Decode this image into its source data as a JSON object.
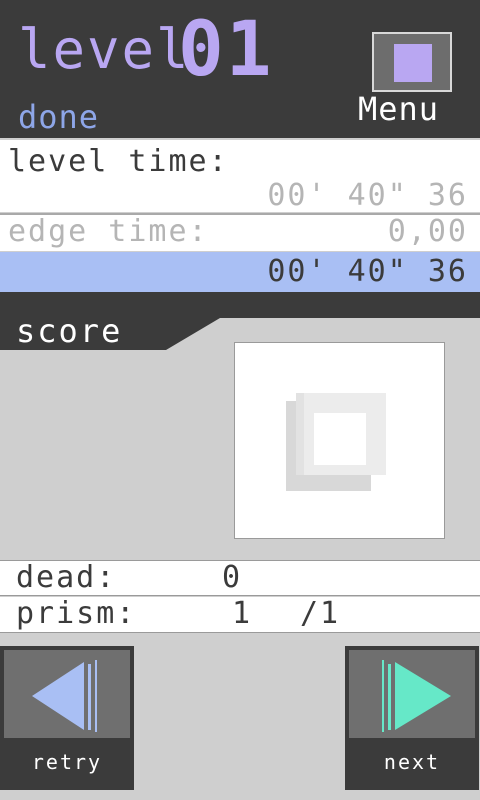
{
  "header": {
    "level_word": "level",
    "level_number": "01",
    "status": "done",
    "menu_label": "Menu"
  },
  "times": {
    "level_time_label": "level time:",
    "level_time_value": "00' 40\" 36",
    "edge_time_label": "edge time:",
    "edge_time_value": "0,00",
    "total_time_value": "00' 40\" 36"
  },
  "score": {
    "label": "score"
  },
  "stats": {
    "dead_label": "dead:",
    "dead_value": "0",
    "prism_label": "prism:",
    "prism_value": "1",
    "prism_total": "/1"
  },
  "buttons": {
    "retry_label": "retry",
    "next_label": "next"
  },
  "colors": {
    "dark": "#3b3b3b",
    "accent_purple": "#b9a7f2",
    "accent_blue": "#a9bff4",
    "retry_arrow": "#a9bff4",
    "next_arrow": "#66e8c8"
  },
  "icons": {
    "menu": "square-menu-icon",
    "score_badge": "empty-square-score-icon",
    "retry": "arrow-left-icon",
    "next": "arrow-right-icon"
  }
}
